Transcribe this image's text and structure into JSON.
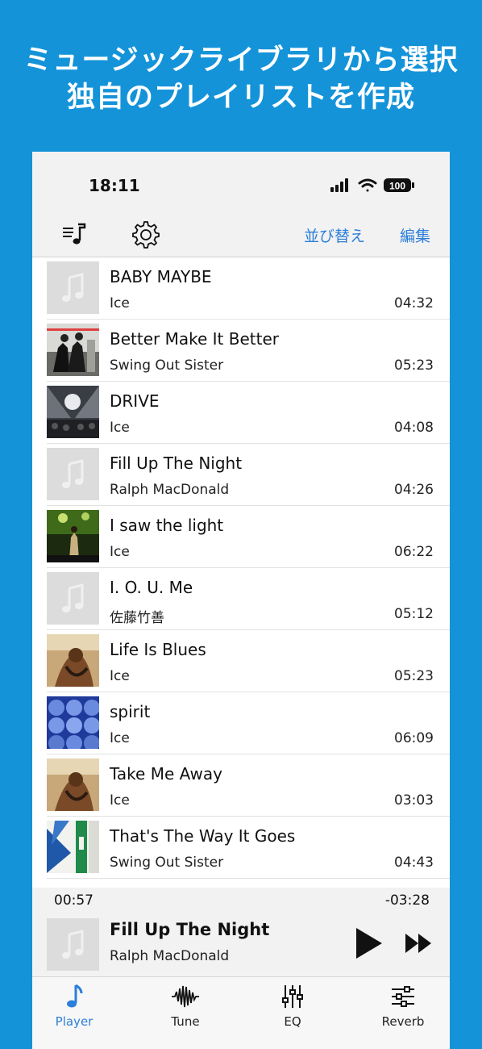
{
  "promo": {
    "line1": "ミュージックライブラリから選択",
    "line2": "独自のプレイリストを作成"
  },
  "status_bar": {
    "time": "18:11",
    "battery": "100"
  },
  "toolbar": {
    "sort_label": "並び替え",
    "edit_label": "編集"
  },
  "tracks": [
    {
      "title": "BABY MAYBE",
      "artist": "Ice",
      "duration": "04:32",
      "art": "placeholder"
    },
    {
      "title": "Better Make It Better",
      "artist": "Swing Out Sister",
      "duration": "05:23",
      "art": "photo-street"
    },
    {
      "title": "DRIVE",
      "artist": "Ice",
      "duration": "04:08",
      "art": "photo-concert"
    },
    {
      "title": "Fill Up The Night",
      "artist": "Ralph MacDonald",
      "duration": "04:26",
      "art": "placeholder"
    },
    {
      "title": "I saw the light",
      "artist": "Ice",
      "duration": "06:22",
      "art": "photo-stage-green"
    },
    {
      "title": "I. O. U. Me",
      "artist": "佐藤竹善",
      "duration": "05:12",
      "art": "placeholder"
    },
    {
      "title": "Life Is Blues",
      "artist": "Ice",
      "duration": "05:23",
      "art": "photo-portrait"
    },
    {
      "title": "spirit",
      "artist": "Ice",
      "duration": "06:09",
      "art": "photo-blue-circles"
    },
    {
      "title": "Take Me Away",
      "artist": "Ice",
      "duration": "03:03",
      "art": "photo-portrait"
    },
    {
      "title": "That's The Way It Goes",
      "artist": "Swing Out Sister",
      "duration": "04:43",
      "art": "photo-blue-green"
    }
  ],
  "now_playing": {
    "elapsed": "00:57",
    "remaining": "-03:28",
    "title": "Fill Up The Night",
    "artist": "Ralph MacDonald"
  },
  "tabs": [
    {
      "label": "Player",
      "icon": "music-note-icon",
      "active": true
    },
    {
      "label": "Tune",
      "icon": "waveform-icon",
      "active": false
    },
    {
      "label": "EQ",
      "icon": "equalizer-icon",
      "active": false
    },
    {
      "label": "Reverb",
      "icon": "sliders-icon",
      "active": false
    }
  ],
  "colors": {
    "background": "#1493d9",
    "accent": "#2b7fd8"
  }
}
